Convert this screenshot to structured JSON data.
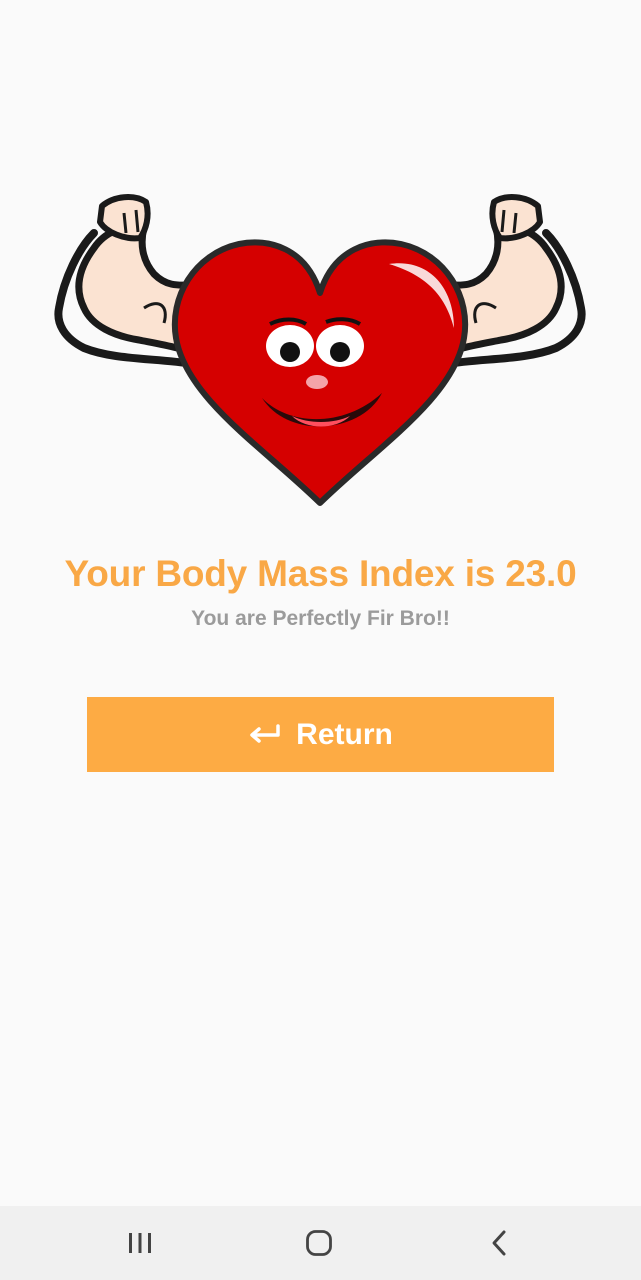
{
  "result": {
    "title": "Your Body Mass Index is 23.0",
    "message": "You are Perfectly Fir Bro!!"
  },
  "actions": {
    "return_label": "Return",
    "return_icon": "return-arrow-icon"
  },
  "navbar": {
    "recents_icon": "recents-icon",
    "home_icon": "home-icon",
    "back_icon": "back-icon"
  },
  "colors": {
    "accent": "#fdab44",
    "title": "#f9a846",
    "subtitle": "#9b9b9b",
    "heart": "#d50000",
    "background": "#fafafa"
  }
}
